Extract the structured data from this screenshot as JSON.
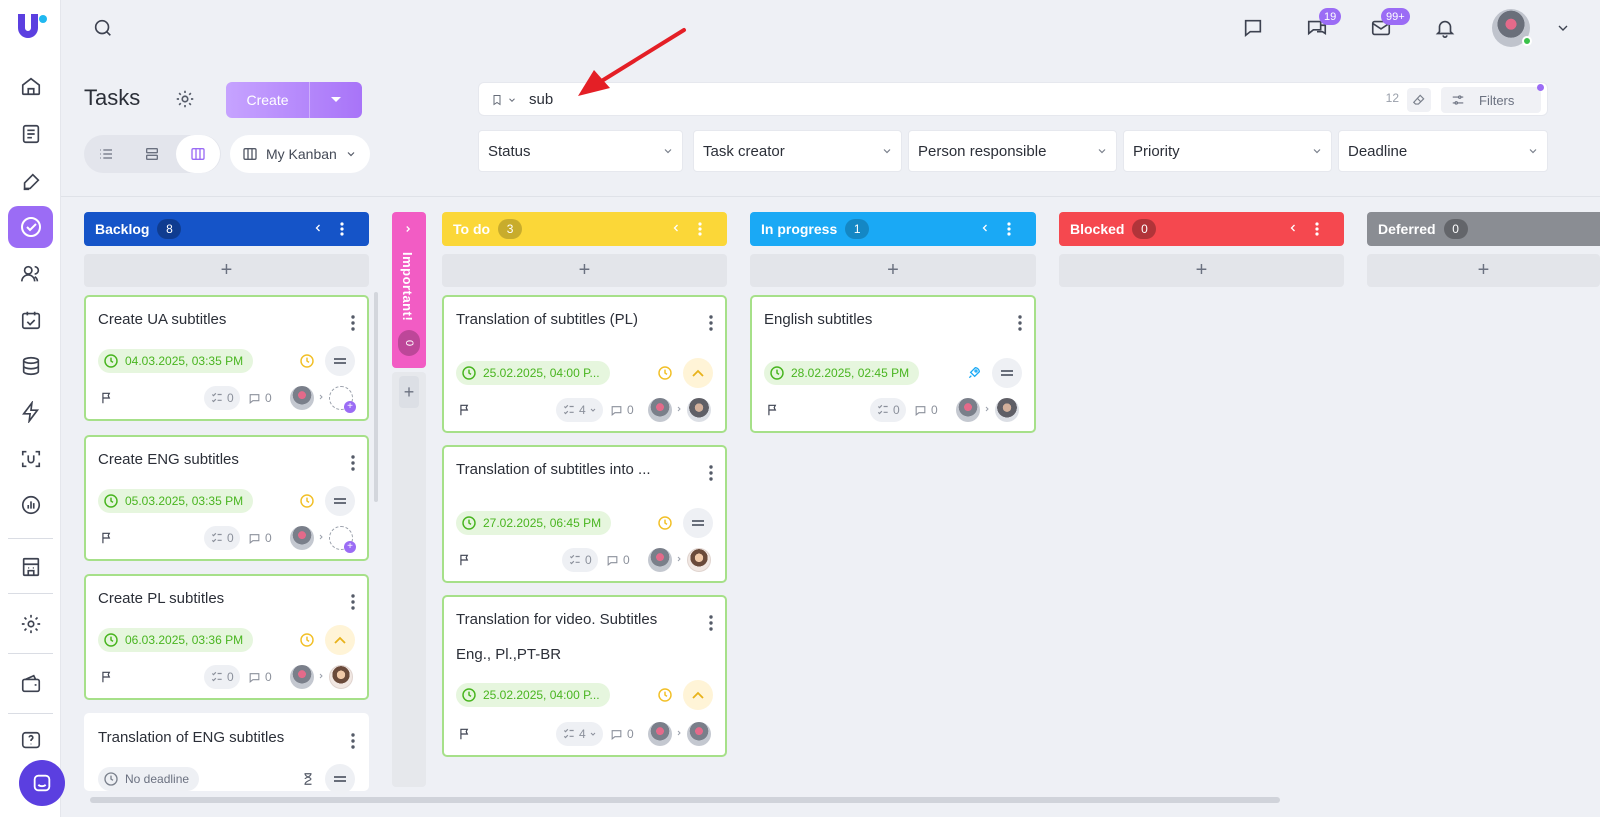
{
  "topbar": {
    "chat_badge": "19",
    "mail_badge": "99+"
  },
  "header": {
    "title": "Tasks",
    "create_label": "Create",
    "kanban_label": "My Kanban"
  },
  "search": {
    "value": "sub",
    "count": "12",
    "filters_label": "Filters"
  },
  "filters": [
    "Status",
    "Task creator",
    "Person responsible",
    "Priority",
    "Deadline"
  ],
  "important_column": {
    "label": "Important!",
    "count": "0"
  },
  "columns": [
    {
      "name": "Backlog",
      "count": "8",
      "color": "#1554c8"
    },
    {
      "name": "To do",
      "count": "3",
      "color": "#fbd738"
    },
    {
      "name": "In progress",
      "count": "1",
      "color": "#1aa9f5"
    },
    {
      "name": "Blocked",
      "count": "0",
      "color": "#f5484f"
    },
    {
      "name": "Deferred",
      "count": "0",
      "color": "#8a8d93"
    }
  ],
  "cards": {
    "backlog": [
      {
        "title": "Create UA subtitles",
        "date": "04.03.2025, 03:35 PM",
        "subtasks": "0",
        "comments": "0"
      },
      {
        "title": "Create ENG subtitles",
        "date": "05.03.2025, 03:35 PM",
        "subtasks": "0",
        "comments": "0"
      },
      {
        "title": "Create PL subtitles",
        "date": "06.03.2025, 03:36 PM",
        "subtasks": "0",
        "comments": "0"
      },
      {
        "title": "Translation of ENG subtitles",
        "date": "No deadline"
      }
    ],
    "todo": [
      {
        "title": "Translation of subtitles (PL)",
        "date": "25.02.2025, 04:00 P...",
        "subtasks": "4",
        "comments": "0"
      },
      {
        "title": "Translation of subtitles into ...",
        "date": "27.02.2025, 06:45 PM",
        "subtasks": "0",
        "comments": "0"
      },
      {
        "title": "Translation for video. Subtitles",
        "desc": "Eng., Pl.,PT-BR",
        "date": "25.02.2025, 04:00 P...",
        "subtasks": "4",
        "comments": "0"
      }
    ],
    "in_progress": [
      {
        "title": "English subtitles",
        "date": "28.02.2025, 02:45 PM",
        "subtasks": "0",
        "comments": "0"
      }
    ]
  }
}
